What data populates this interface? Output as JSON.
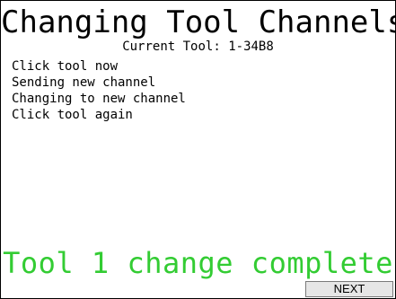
{
  "screen": {
    "title": "Changing Tool Channels",
    "current_tool": "Current Tool: 1-34B8",
    "log": [
      "Click tool now",
      "Sending new channel",
      "Changing to new channel",
      "Click tool again"
    ],
    "status": "Tool 1 change complete",
    "next_label": "NEXT"
  },
  "colors": {
    "status_text": "#33cc33",
    "button_bg": "#e6e6e6",
    "border": "#000000"
  }
}
